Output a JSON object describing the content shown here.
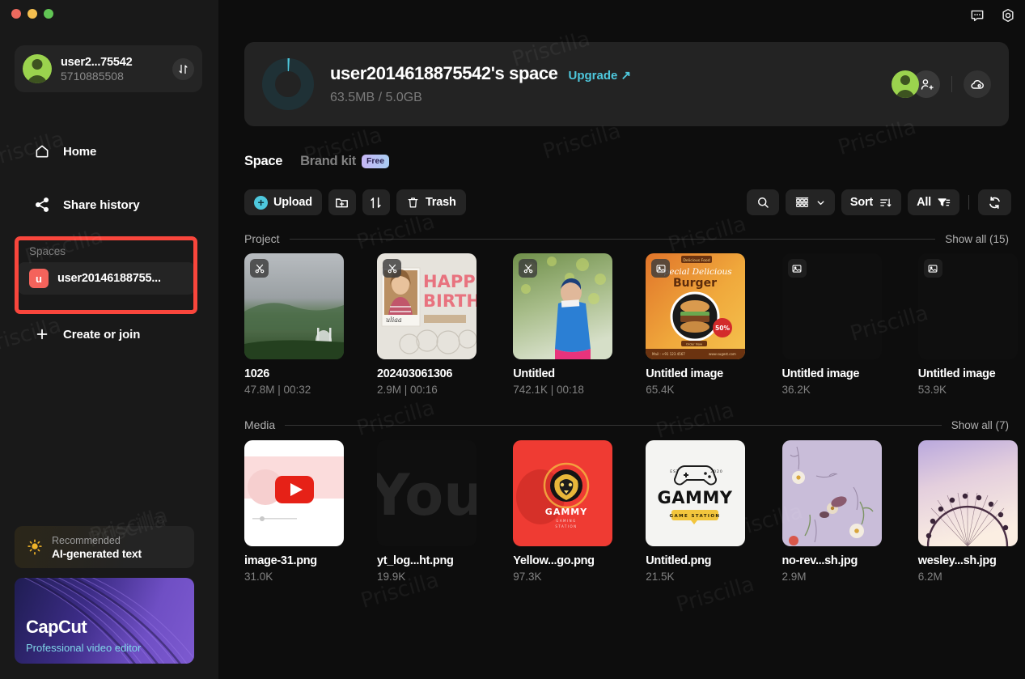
{
  "window": {
    "traffic_lights": [
      "close",
      "minimize",
      "maximize"
    ],
    "colors": {
      "close": "#ed6a5e",
      "minimize": "#f4bf4f",
      "maximize": "#61c554"
    }
  },
  "topbar": {
    "icons": [
      {
        "name": "feedback-chat-icon",
        "label": "Feedback"
      },
      {
        "name": "settings-gear-icon",
        "label": "Settings"
      }
    ]
  },
  "sidebar": {
    "account": {
      "name": "user2...75542",
      "id": "5710885508",
      "switch_icon": "swap-arrows-icon"
    },
    "nav": [
      {
        "name": "home",
        "label": "Home",
        "icon": "home-icon"
      },
      {
        "name": "share-history",
        "label": "Share history",
        "icon": "share-icon"
      }
    ],
    "spaces": {
      "header": "Spaces",
      "items": [
        {
          "badge": "u",
          "label": "user20146188755...",
          "badge_color": "#f4635b"
        }
      ]
    },
    "create_or_join": {
      "label": "Create or join",
      "icon": "plus-icon"
    },
    "promo_ai": {
      "eyebrow": "Recommended",
      "title": "AI-generated text",
      "icon": "lightbulb-icon"
    },
    "promo_capcut": {
      "title": "CapCut",
      "subtitle": "Professional video editor"
    }
  },
  "hero": {
    "title": "user2014618875542's space",
    "upgrade_label": "Upgrade",
    "upgrade_icon": "arrow-up-right-icon",
    "storage_used": "63.5MB",
    "storage_total": "5.0GB",
    "storage_text": "63.5MB / 5.0GB",
    "storage_percent": 1.24,
    "accent_color": "#4ec8dd",
    "actions": [
      {
        "name": "member-avatar",
        "icon": "avatar-icon"
      },
      {
        "name": "invite-member",
        "icon": "person-add-icon"
      },
      {
        "name": "cloud-upload",
        "icon": "cloud-icon"
      }
    ]
  },
  "tabs": [
    {
      "name": "space",
      "label": "Space",
      "active": true
    },
    {
      "name": "brand-kit",
      "label": "Brand kit",
      "active": false,
      "badge": "Free"
    }
  ],
  "toolbar": {
    "upload_label": "Upload",
    "new_folder_icon": "folder-plus-icon",
    "sort_toggle_icon": "sort-arrows-icon",
    "trash_label": "Trash",
    "trash_icon": "trash-icon"
  },
  "toolbar_right": {
    "search_icon": "search-icon",
    "view_icon": "grid-view-icon",
    "view_chevron": "chevron-down-icon",
    "sort_label": "Sort",
    "sort_icon": "sort-descending-icon",
    "filter_label": "All",
    "filter_icon": "filter-icon",
    "refresh_icon": "refresh-icon"
  },
  "sections": [
    {
      "name": "project",
      "title": "Project",
      "show_all": "Show all (15)",
      "items": [
        {
          "title": "1026",
          "meta": "47.8M | 00:32",
          "badge": "scissors-icon",
          "thumb": "mountain-fog"
        },
        {
          "title": "202403061306",
          "meta": "2.9M | 00:16",
          "badge": "scissors-icon",
          "thumb": "happy-birthday"
        },
        {
          "title": "Untitled",
          "meta": "742.1K | 00:18",
          "badge": "scissors-icon",
          "thumb": "person-blue-jacket"
        },
        {
          "title": "Untitled image",
          "meta": "65.4K",
          "badge": "image-icon",
          "thumb": "burger-poster"
        },
        {
          "title": "Untitled image",
          "meta": "36.2K",
          "badge": "image-icon",
          "thumb": "empty"
        },
        {
          "title": "Untitled image",
          "meta": "53.9K",
          "badge": "image-icon",
          "thumb": "empty"
        }
      ]
    },
    {
      "name": "media",
      "title": "Media",
      "show_all": "Show all (7)",
      "items": [
        {
          "title": "image-31.png",
          "meta": "31.0K",
          "thumb": "youtube-play"
        },
        {
          "title": "yt_log...ht.png",
          "meta": "19.9K",
          "thumb": "you-text-dark"
        },
        {
          "title": "Yellow...go.png",
          "meta": "97.3K",
          "thumb": "gammy-lion-red"
        },
        {
          "title": "Untitled.png",
          "meta": "21.5K",
          "thumb": "gammy-white"
        },
        {
          "title": "no-rev...sh.jpg",
          "meta": "2.9M",
          "thumb": "purple-flowers"
        },
        {
          "title": "wesley...sh.jpg",
          "meta": "6.2M",
          "thumb": "ferris-wheel"
        }
      ]
    }
  ],
  "annotation": {
    "type": "highlight-box",
    "color": "#f9463c",
    "target": "spaces-section"
  },
  "watermark": {
    "text": "Priscilla"
  }
}
